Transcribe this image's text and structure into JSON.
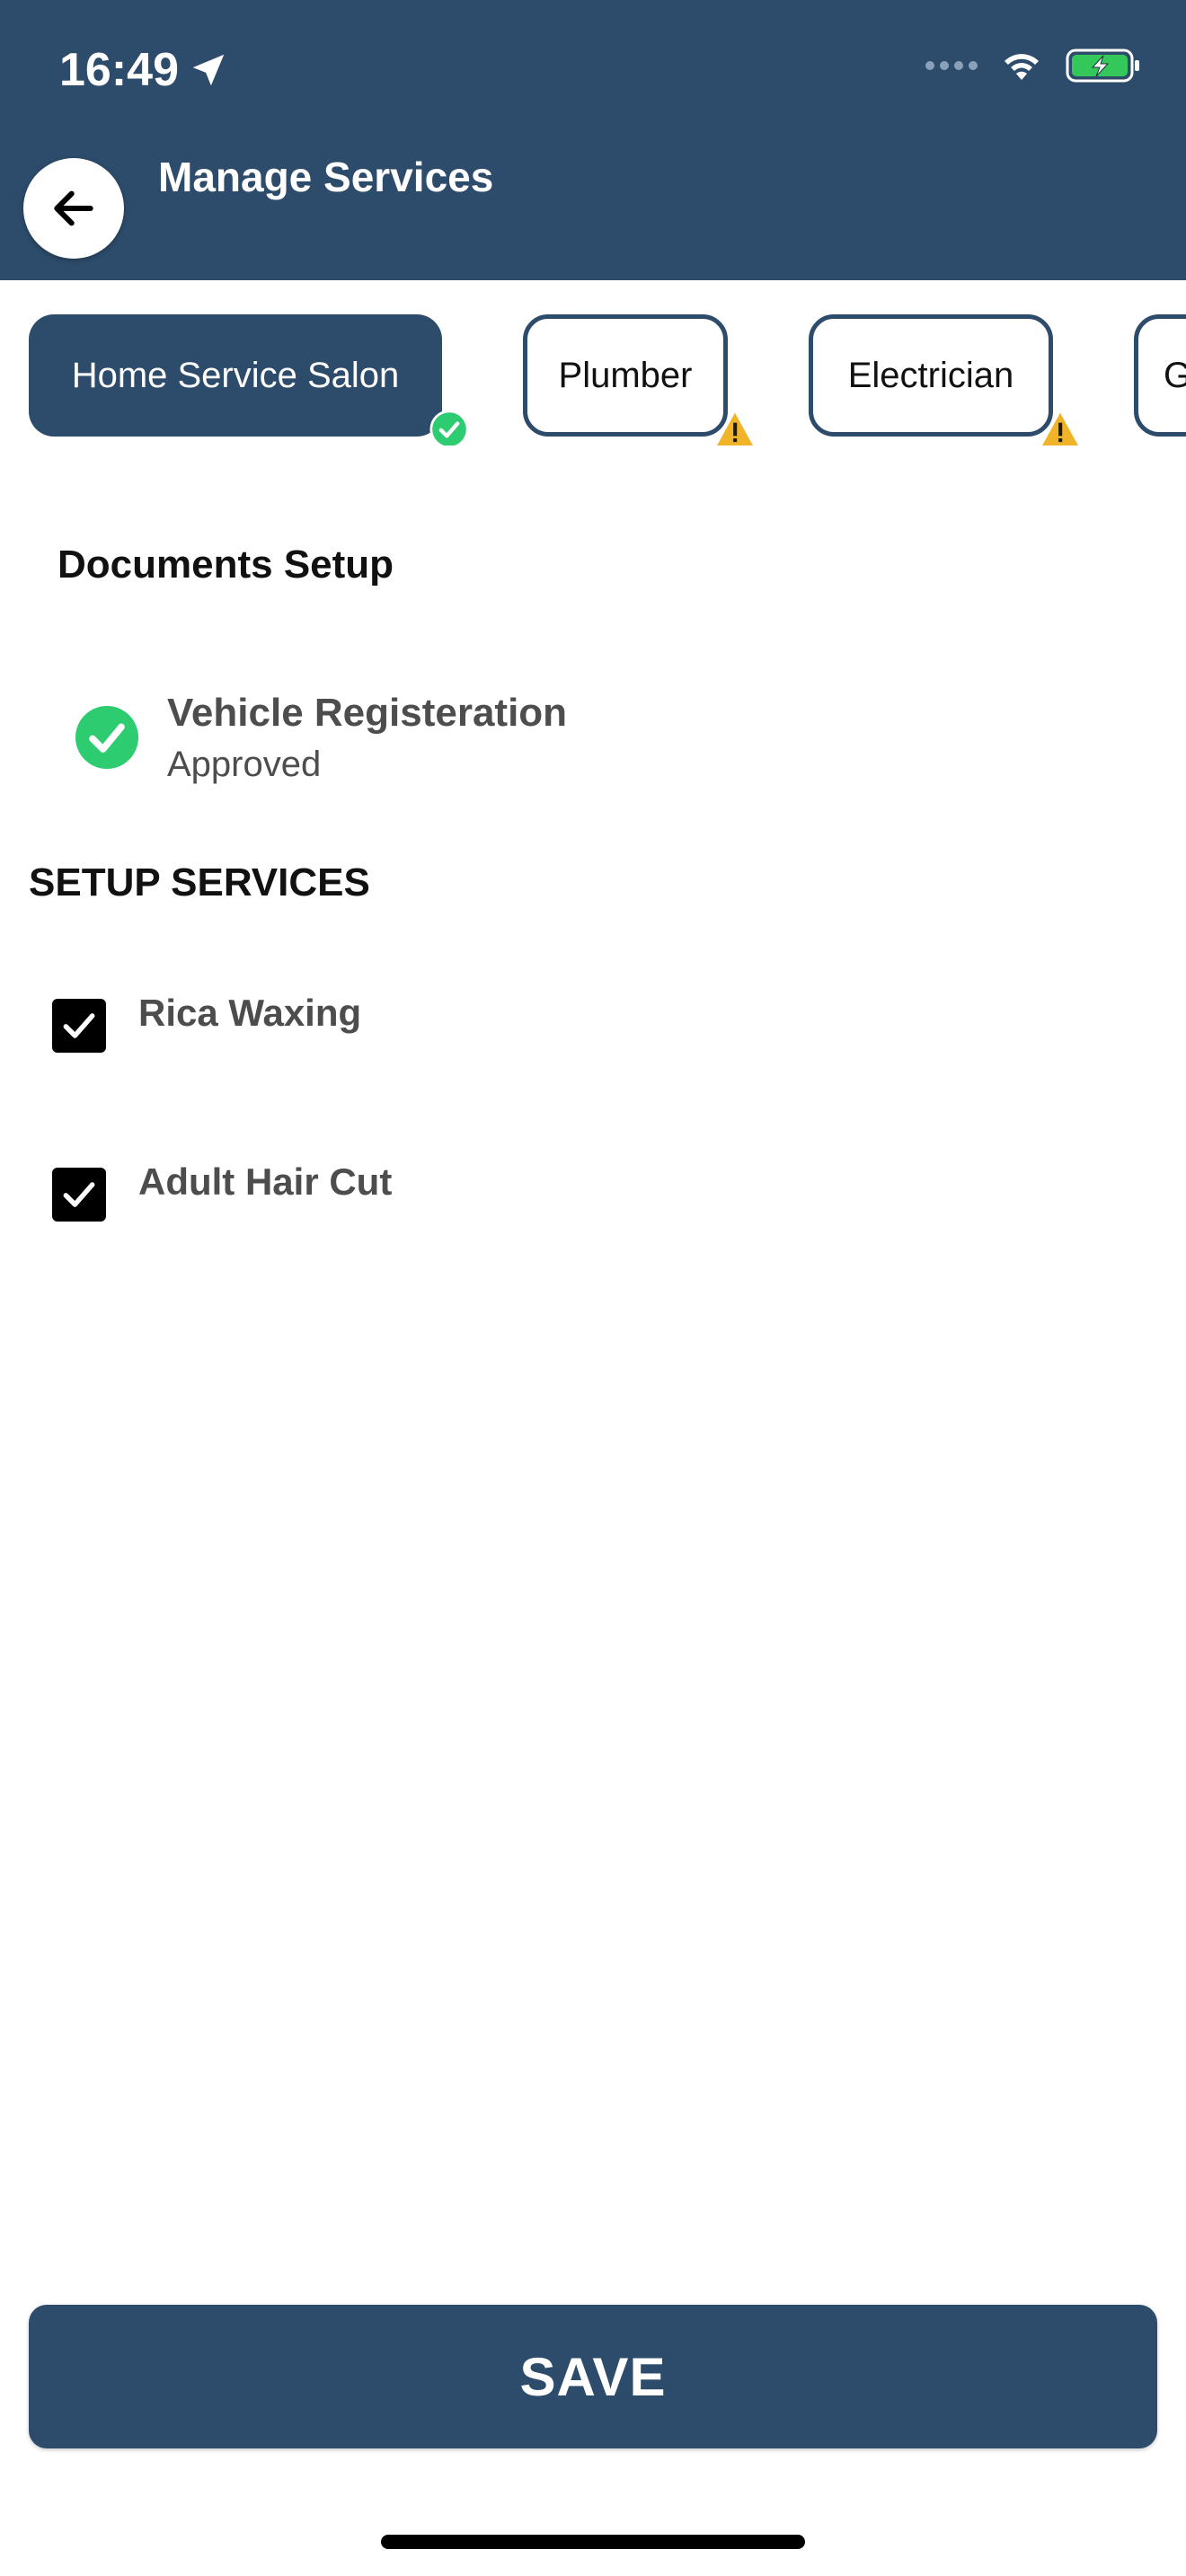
{
  "status_bar": {
    "time": "16:49"
  },
  "header": {
    "title": "Manage Services"
  },
  "categories": [
    {
      "label": "Home Service Salon",
      "state": "approved"
    },
    {
      "label": "Plumber",
      "state": "warning"
    },
    {
      "label": "Electrician",
      "state": "warning"
    },
    {
      "label": "G",
      "state": "partial"
    }
  ],
  "documents": {
    "title": "Documents Setup",
    "items": [
      {
        "name": "Vehicle Registeration",
        "status": "Approved"
      }
    ]
  },
  "setup_services": {
    "title": "SETUP SERVICES",
    "items": [
      {
        "label": "Rica Waxing",
        "checked": true
      },
      {
        "label": "Adult Hair Cut",
        "checked": true
      }
    ]
  },
  "save_button": {
    "label": "SAVE"
  },
  "colors": {
    "primary": "#2d4b6a",
    "success": "#2ecc71",
    "warning": "#f0b429"
  },
  "icons": {
    "back": "arrow-left-icon",
    "location": "location-arrow-icon",
    "wifi": "wifi-icon",
    "battery": "battery-charging-icon",
    "approved": "check-circle-icon",
    "warning": "warning-triangle-icon",
    "checkbox": "checkbox-checked-icon"
  }
}
